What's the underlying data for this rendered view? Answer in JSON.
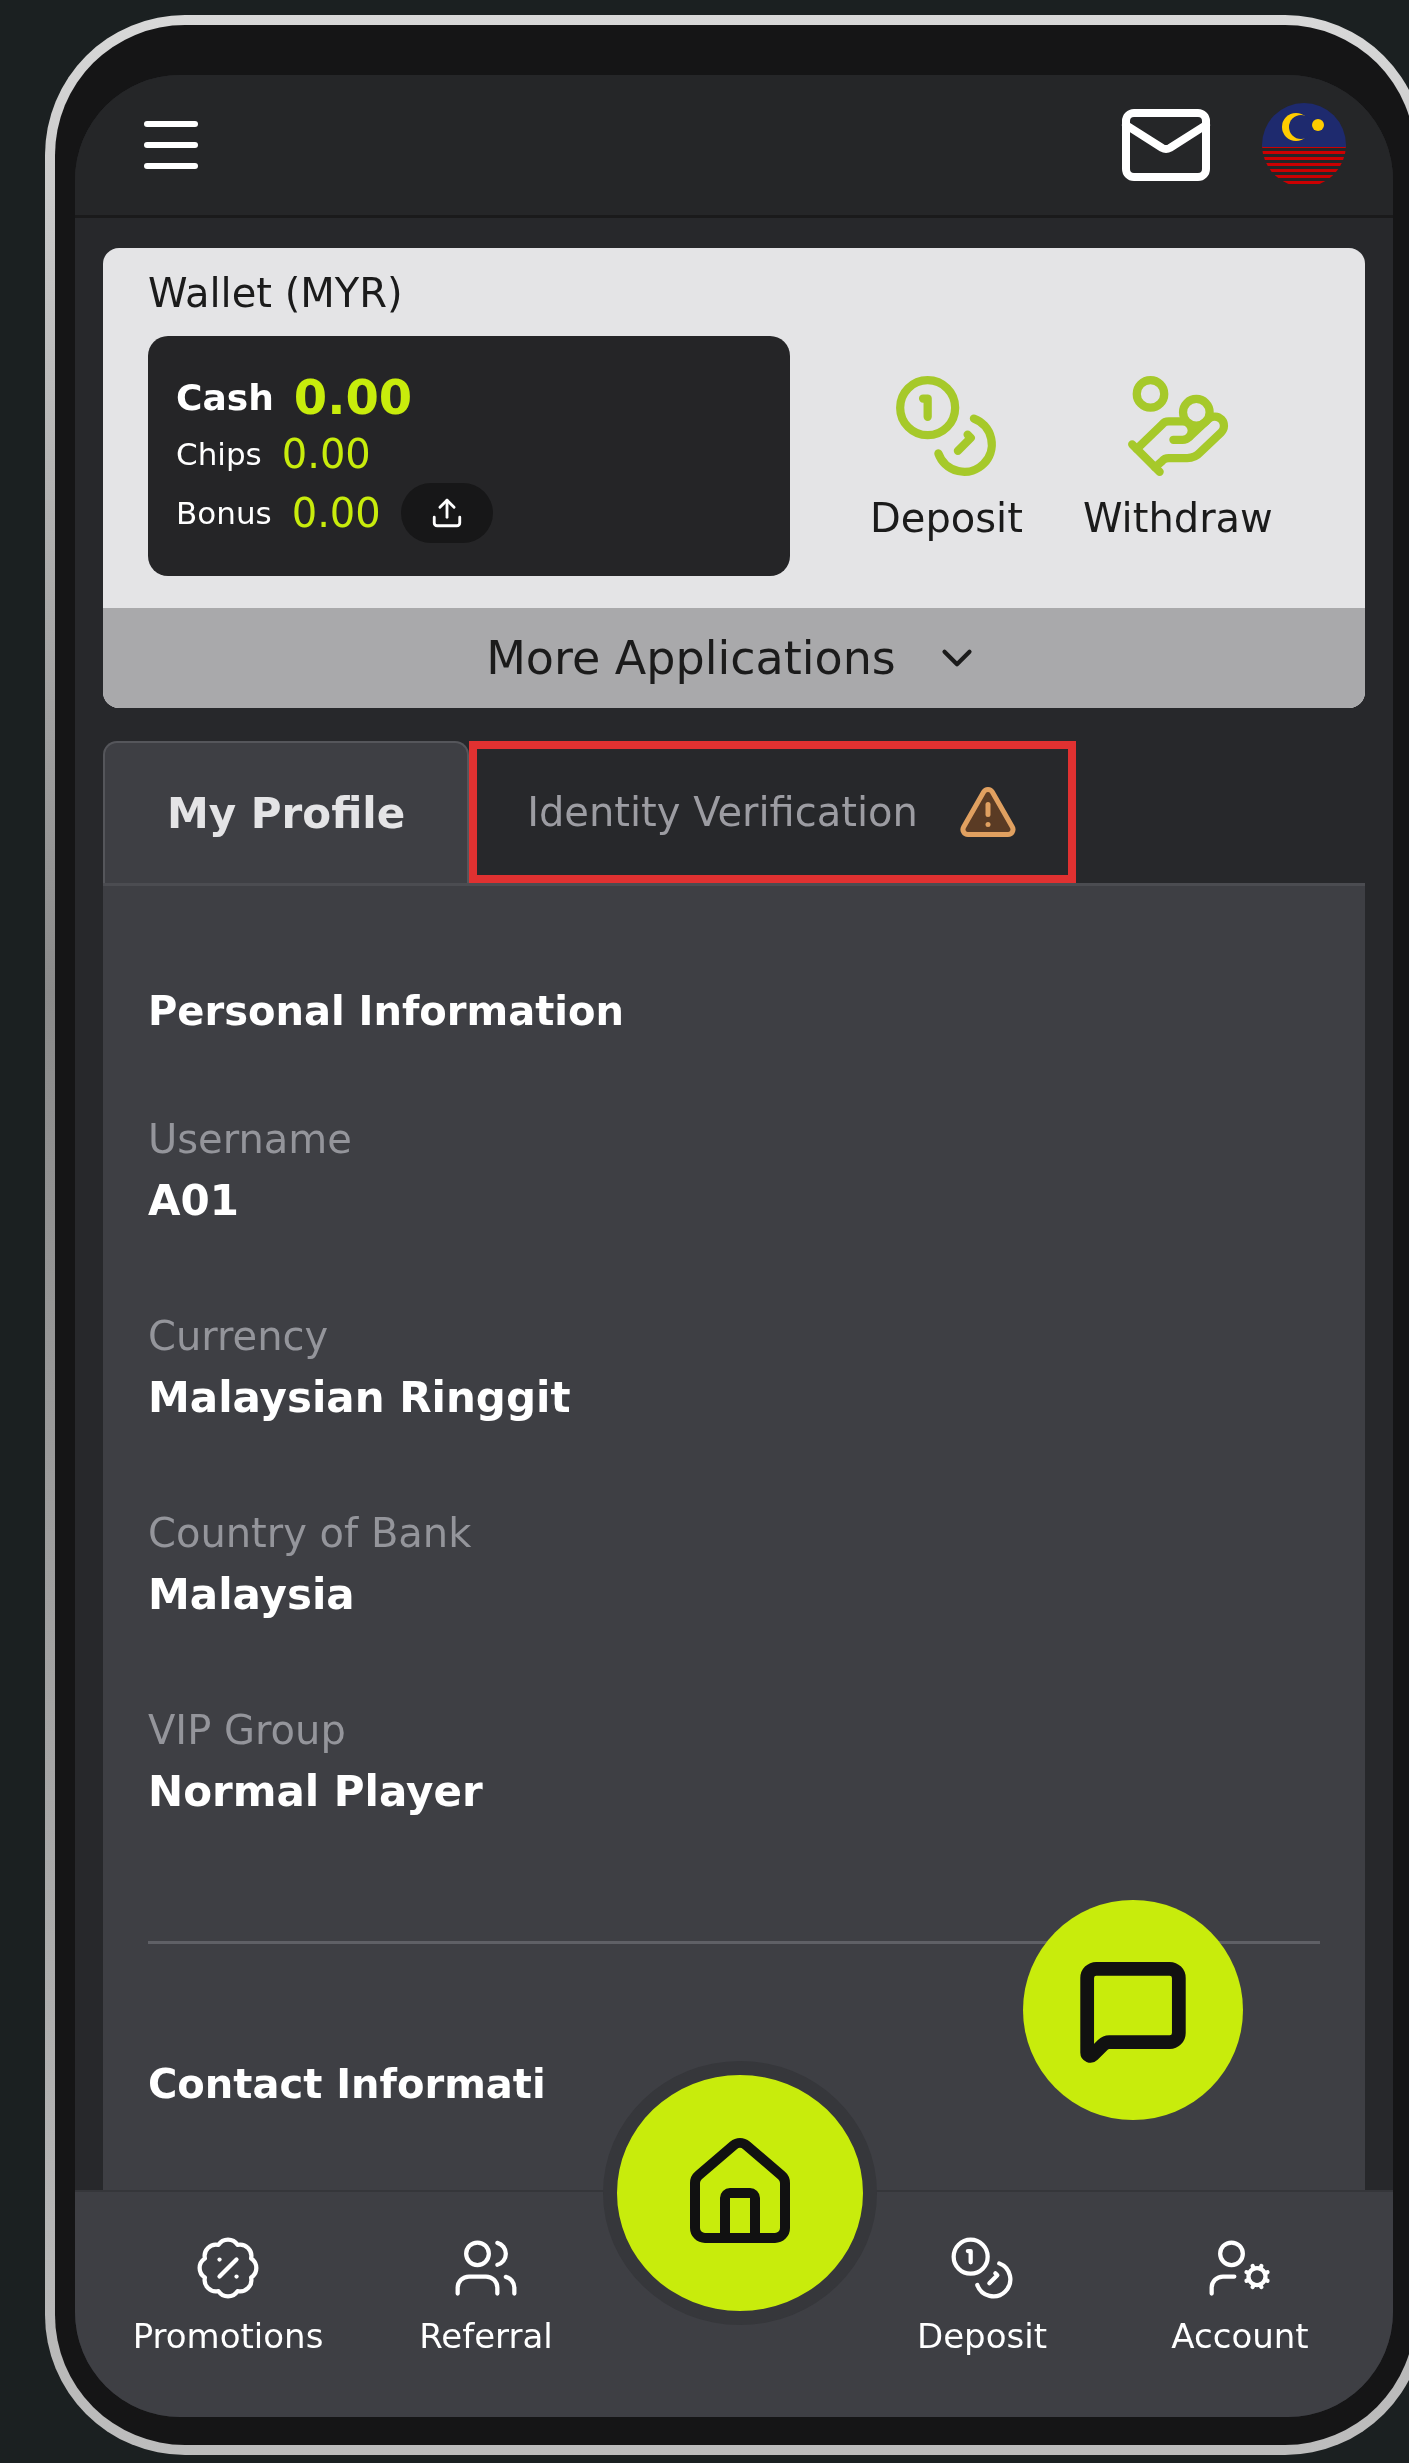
{
  "wallet": {
    "title": "Wallet (MYR)",
    "more": "More Applications",
    "balances": [
      {
        "label": "Cash",
        "amount": "0.00",
        "kind": "main"
      },
      {
        "label": "Chips",
        "amount": "0.00",
        "kind": "sub"
      },
      {
        "label": "Bonus",
        "amount": "0.00",
        "kind": "transfer"
      }
    ],
    "actions": [
      {
        "label": "Deposit",
        "kind": "deposit"
      },
      {
        "label": "Withdraw",
        "kind": "withdraw"
      }
    ]
  },
  "tabs": [
    {
      "label": "My Profile",
      "selected": true,
      "warning": false,
      "highlighted": false
    },
    {
      "label": "Identity Verification",
      "selected": false,
      "warning": true,
      "highlighted": true
    }
  ],
  "sections": [
    {
      "title": "Personal Information",
      "fields": [
        {
          "label": "Username",
          "value": "A01"
        },
        {
          "label": "Currency",
          "value": "Malaysian Ringgit"
        },
        {
          "label": "Country of Bank",
          "value": "Malaysia"
        },
        {
          "label": "VIP Group",
          "value": "Normal Player"
        }
      ]
    },
    {
      "title": "Contact Informati"
    }
  ],
  "bottom_nav": [
    {
      "label": "Promotions",
      "kind": "promotions"
    },
    {
      "label": "Referral",
      "kind": "referral"
    },
    {
      "label": "Deposit",
      "kind": "deposit"
    },
    {
      "label": "Account",
      "kind": "account"
    }
  ]
}
